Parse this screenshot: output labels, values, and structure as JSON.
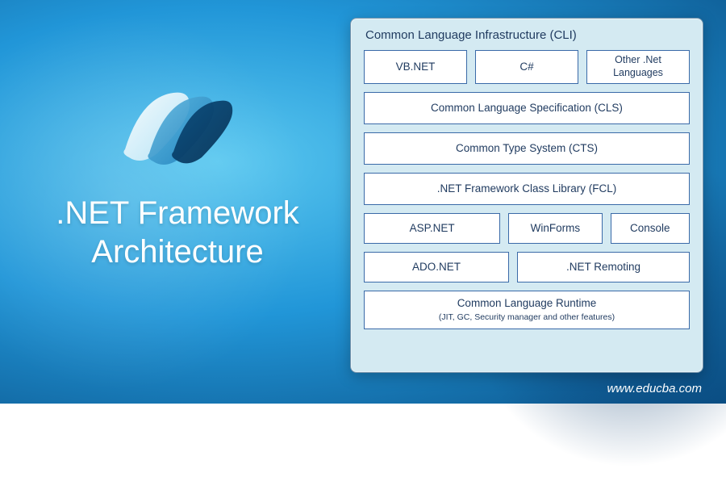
{
  "title_line1": ".NET Framework",
  "title_line2": "Architecture",
  "watermark": "www.educba.com",
  "diagram": {
    "container_title": "Common Language Infrastructure (CLI)",
    "languages": {
      "vbnet": "VB.NET",
      "csharp": "C#",
      "other": "Other .Net Languages"
    },
    "cls": "Common Language Specification (CLS)",
    "cts": "Common Type System (CTS)",
    "fcl": ".NET Framework Class Library (FCL)",
    "ui_layer": {
      "aspnet": "ASP.NET",
      "winforms": "WinForms",
      "console": "Console"
    },
    "data_layer": {
      "adonet": "ADO.NET",
      "remoting": ".NET Remoting"
    },
    "clr": {
      "title": "Common Language Runtime",
      "sub": "(JIT, GC, Security manager and other features)"
    }
  }
}
